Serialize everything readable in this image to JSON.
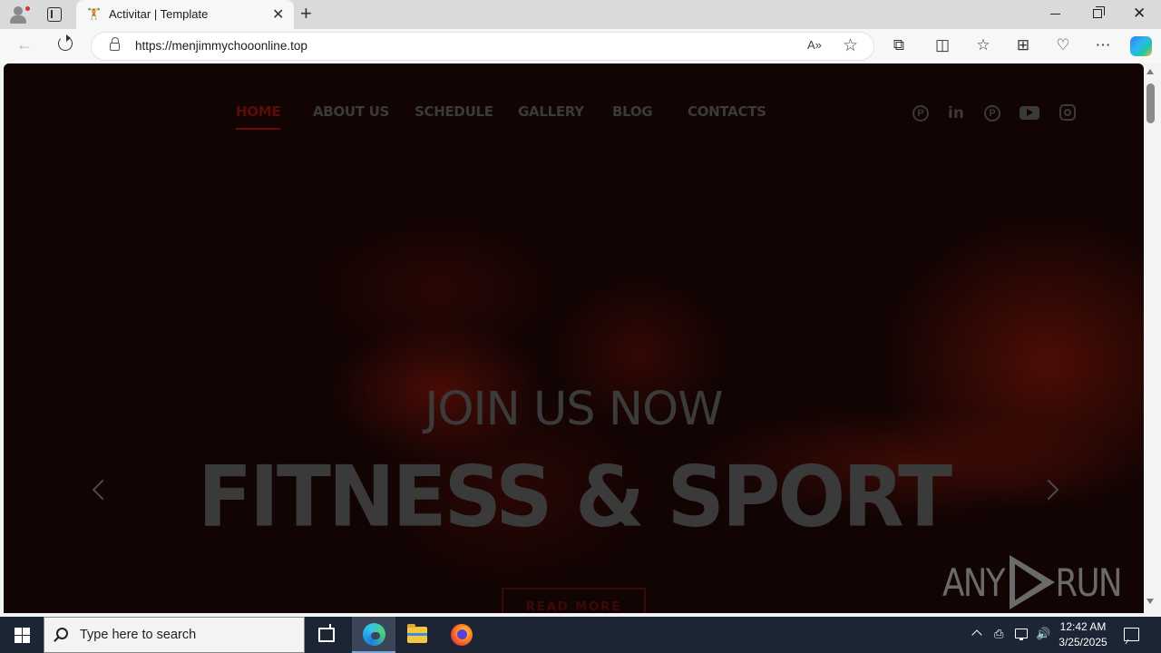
{
  "browser": {
    "tab_title": "Activitar | Template",
    "tab_favicon": "🏋",
    "tab_close": "✕",
    "new_tab": "+",
    "url": "https://menjimmychooonline.top",
    "read_aloud": "A»",
    "favorite_star": "☆",
    "back": "←",
    "close_window": "✕",
    "toolbar_icons": {
      "extensions": "⧉",
      "split_screen": "◫",
      "favorites": "☆",
      "collections": "⊞",
      "browser_essentials": "♡",
      "more": "⋯"
    }
  },
  "site": {
    "nav": [
      {
        "label": "HOME",
        "active": true
      },
      {
        "label": "ABOUT US",
        "active": false
      },
      {
        "label": "SCHEDULE",
        "active": false
      },
      {
        "label": "GALLERY",
        "active": false
      },
      {
        "label": "BLOG",
        "active": false
      },
      {
        "label": "CONTACTS",
        "active": false
      }
    ],
    "social": {
      "pinterest_1": "P",
      "linkedin": "in",
      "pinterest_2": "P"
    },
    "hero": {
      "subtitle": "JOIN US NOW",
      "title": "FITNESS & SPORT",
      "button": "READ MORE"
    },
    "watermark": {
      "left": "ANY",
      "right": "RUN"
    }
  },
  "taskbar": {
    "search_placeholder": "Type here to search",
    "time": "12:42 AM",
    "date": "3/25/2025",
    "tray_speaker": "🔊",
    "tray_meet": "⎙"
  },
  "colors": {
    "accent_red": "#6a0d08",
    "page_dark": "#120403",
    "taskbar": "#1c2533"
  }
}
